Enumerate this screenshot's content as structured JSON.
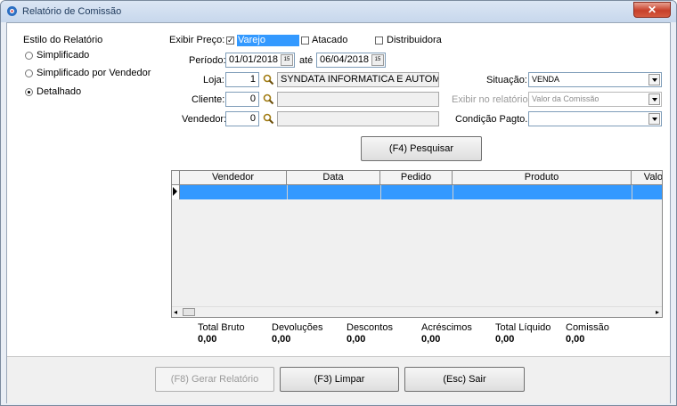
{
  "window": {
    "title": "Relatório de Comissão",
    "close_glyph": "✕"
  },
  "estilo": {
    "heading": "Estilo do Relatório",
    "options": [
      {
        "label": "Simplificado",
        "selected": false
      },
      {
        "label": "Simplificado por Vendedor",
        "selected": false
      },
      {
        "label": "Detalhado",
        "selected": true
      }
    ]
  },
  "filtros": {
    "exibir_preco_label": "Exibir Preço:",
    "varejo": {
      "label": "Varejo",
      "checked": true
    },
    "atacado": {
      "label": "Atacado",
      "checked": false
    },
    "distribuidora": {
      "label": "Distribuidora",
      "checked": false
    },
    "periodo_label": "Período:",
    "data_inicio": "01/01/2018",
    "ate_label": "até",
    "data_fim": "06/04/2018",
    "calendar_glyph": "15",
    "loja_label": "Loja:",
    "loja_codigo": "1",
    "loja_nome": "SYNDATA INFORMATICA E AUTOMAC",
    "cliente_label": "Cliente:",
    "cliente_codigo": "0",
    "cliente_nome": "",
    "vendedor_label": "Vendedor:",
    "vendedor_codigo": "0",
    "vendedor_nome": "",
    "situacao_label": "Situação:",
    "situacao_value": "VENDA",
    "exibir_relatorio_label": "Exibir no relatório:",
    "exibir_relatorio_value": "Valor da Comissão",
    "condicao_label": "Condição Pagto.:",
    "condicao_value": ""
  },
  "pesquisar_button": "(F4) Pesquisar",
  "grid": {
    "columns": [
      "Vendedor",
      "Data",
      "Pedido",
      "Produto",
      "Valo"
    ]
  },
  "totais": [
    {
      "label": "Total Bruto",
      "value": "0,00"
    },
    {
      "label": "Devoluções",
      "value": "0,00"
    },
    {
      "label": "Descontos",
      "value": "0,00"
    },
    {
      "label": "Acréscimos",
      "value": "0,00"
    },
    {
      "label": "Total Líquido",
      "value": "0,00"
    },
    {
      "label": "Comissão",
      "value": "0,00"
    }
  ],
  "footer": {
    "gerar": "(F8) Gerar Relatório",
    "limpar": "(F3) Limpar",
    "sair": "(Esc) Sair"
  },
  "colors": {
    "selection": "#3399ff",
    "title_text": "#1e395b",
    "close_button": "#c7402a"
  }
}
